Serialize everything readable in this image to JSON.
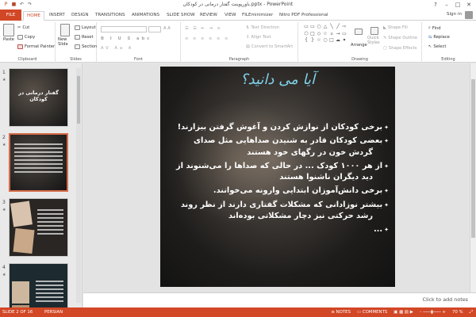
{
  "window": {
    "title": "باورپوینت گفتار درمانی در کودکان.pptx - PowerPoint",
    "help": "?",
    "minimize": "–",
    "restore": "□",
    "close": "✕"
  },
  "tabs": [
    "FILE",
    "HOME",
    "INSERT",
    "DESIGN",
    "TRANSITIONS",
    "ANIMATIONS",
    "SLIDE SHOW",
    "REVIEW",
    "VIEW",
    "FILEminimizer",
    "Nitro PDF Professional"
  ],
  "active_tab": "HOME",
  "signin": "Sign in",
  "ribbon": {
    "clipboard": {
      "label": "Clipboard",
      "paste": "Paste",
      "cut": "Cut",
      "copy": "Copy",
      "format_painter": "Format Painter"
    },
    "slides": {
      "label": "Slides",
      "new_slide": "New Slide",
      "layout": "Layout",
      "reset": "Reset",
      "section": "Section"
    },
    "font": {
      "label": "Font"
    },
    "paragraph": {
      "label": "Paragraph",
      "text_direction": "Text Direction",
      "align_text": "Align Text",
      "convert_smartart": "Convert to SmartArt"
    },
    "drawing": {
      "label": "Drawing",
      "arrange": "Arrange",
      "quick_styles": "Quick Styles",
      "shape_fill": "Shape Fill",
      "shape_outline": "Shape Outline",
      "shape_effects": "Shape Effects"
    },
    "editing": {
      "label": "Editing",
      "find": "Find",
      "replace": "Replace",
      "select": "Select"
    }
  },
  "thumbnails": [
    {
      "num": "1",
      "title": "گفتار درمانی در کودکان"
    },
    {
      "num": "2",
      "title": ""
    },
    {
      "num": "3",
      "title": ""
    },
    {
      "num": "4",
      "title": ""
    }
  ],
  "slide": {
    "title": "آیا می دانید؟",
    "bullets": [
      "برخی کودکان از نوازش کردن و آغوش گرفتن بیزارند!",
      "بعضی کودکان قادر به شنیدن صداهایی مثل صدای",
      "گردش خون در رگهای خود هستند",
      "از هر ۱۰۰۰ کودک ... در حالی که صداها را می‌شنوند از",
      "دید دیگران ناشنوا هستند",
      "برخی دانش‌آموزان ابتدایی وارونه می‌خوانند.",
      "بیشتر نوزادانی که مشکلات گفتاری دارند از نظر روند",
      "رشد حرکتی نیز دچار مشکلاتی بوده‌اند",
      "..."
    ]
  },
  "notes_placeholder": "Click to add notes",
  "status": {
    "slide_of": "SLIDE 2 OF 16",
    "language": "PERSIAN",
    "notes": "NOTES",
    "comments": "COMMENTS",
    "zoom": "70 %"
  },
  "colors": {
    "accent": "#d24726",
    "title_cyan": "#7fd0e8"
  }
}
